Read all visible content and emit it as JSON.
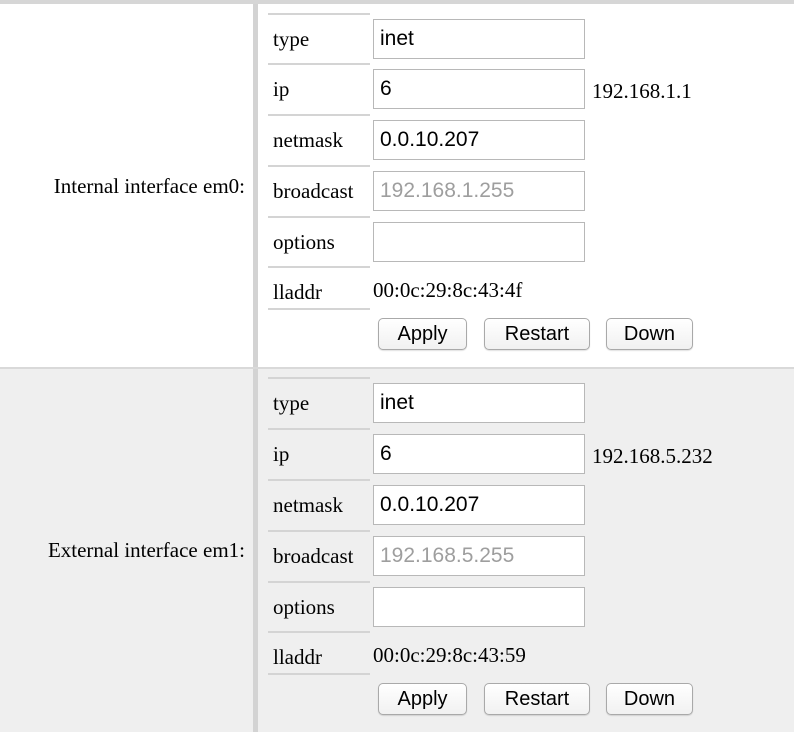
{
  "interfaces": [
    {
      "label": "Internal interface em0:",
      "fields": {
        "type_label": "type",
        "type_value": "inet",
        "ip_label": "ip",
        "ip_value": "6",
        "ip_side": "192.168.1.1",
        "netmask_label": "netmask",
        "netmask_value": "0.0.10.207",
        "broadcast_label": "broadcast",
        "broadcast_placeholder": "192.168.1.255",
        "options_label": "options",
        "options_value": "",
        "lladdr_label": "lladdr",
        "lladdr_value": "00:0c:29:8c:43:4f"
      },
      "buttons": {
        "apply": "Apply",
        "restart": "Restart",
        "down": "Down"
      }
    },
    {
      "label": "External interface em1:",
      "fields": {
        "type_label": "type",
        "type_value": "inet",
        "ip_label": "ip",
        "ip_value": "6",
        "ip_side": "192.168.5.232",
        "netmask_label": "netmask",
        "netmask_value": "0.0.10.207",
        "broadcast_label": "broadcast",
        "broadcast_placeholder": "192.168.5.255",
        "options_label": "options",
        "options_value": "",
        "lladdr_label": "lladdr",
        "lladdr_value": "00:0c:29:8c:43:59"
      },
      "buttons": {
        "apply": "Apply",
        "restart": "Restart",
        "down": "Down"
      }
    }
  ]
}
